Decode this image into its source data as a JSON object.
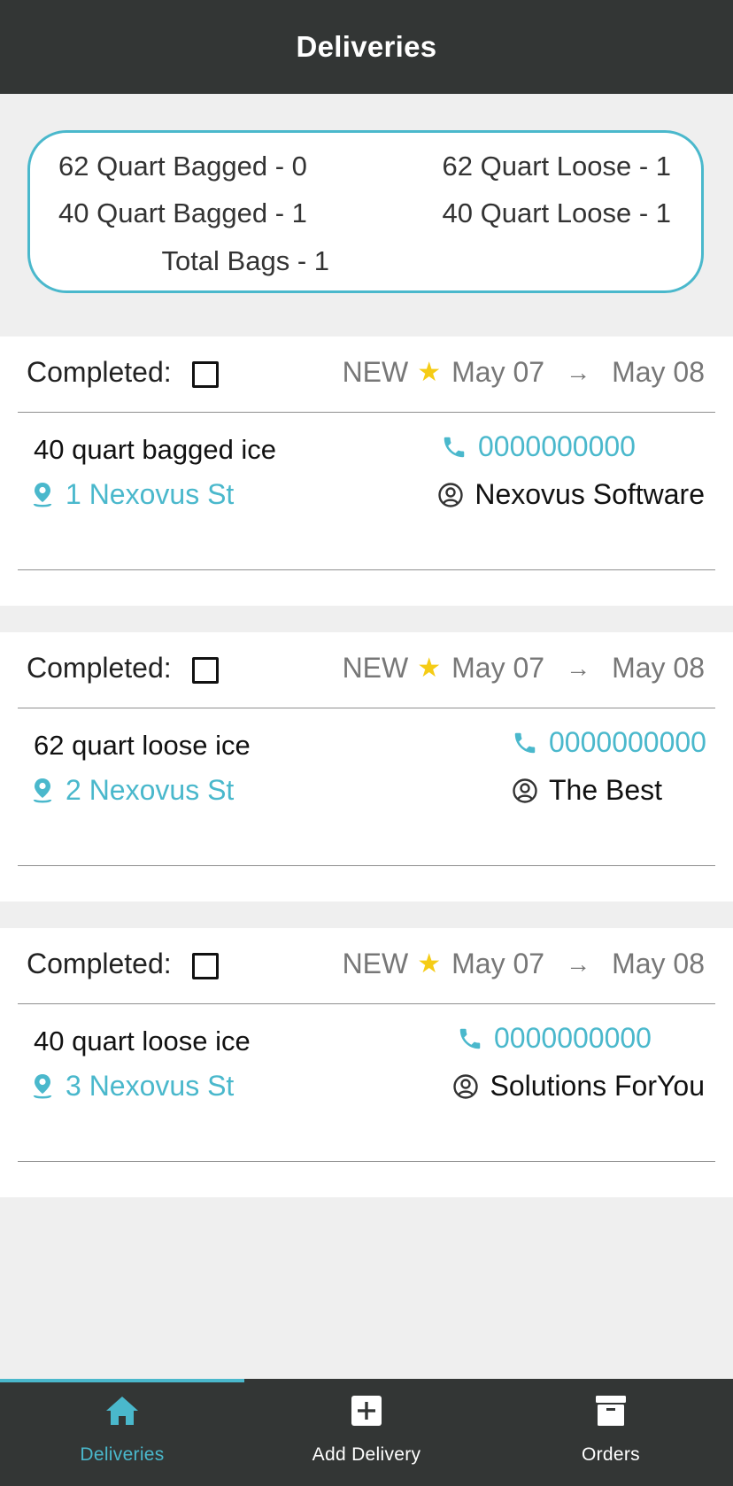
{
  "header": {
    "title": "Deliveries"
  },
  "summary": {
    "bagged_62": "62 Quart Bagged - 0",
    "bagged_40": "40 Quart Bagged - 1",
    "total_bags": "Total Bags - 1",
    "loose_62": "62 Quart Loose - 1",
    "loose_40": "40 Quart Loose - 1"
  },
  "deliveries": [
    {
      "completed_label": "Completed:",
      "status": "NEW",
      "date_from": "May 07",
      "arrow": "→",
      "date_to": "May 08",
      "item": "40 quart bagged ice",
      "address": "1 Nexovus St",
      "phone": "0000000000",
      "customer": "Nexovus Software"
    },
    {
      "completed_label": "Completed:",
      "status": "NEW",
      "date_from": "May 07",
      "arrow": "→",
      "date_to": "May 08",
      "item": "62 quart loose ice",
      "address": "2 Nexovus St",
      "phone": "0000000000",
      "customer": "The Best"
    },
    {
      "completed_label": "Completed:",
      "status": "NEW",
      "date_from": "May 07",
      "arrow": "→",
      "date_to": "May 08",
      "item": "40 quart loose ice",
      "address": "3 Nexovus St",
      "phone": "0000000000",
      "customer": "Solutions ForYou"
    }
  ],
  "tabs": [
    {
      "label": "Deliveries",
      "icon": "home-icon",
      "active": true
    },
    {
      "label": "Add Delivery",
      "icon": "plus-square-icon",
      "active": false
    },
    {
      "label": "Orders",
      "icon": "archive-box-icon",
      "active": false
    }
  ],
  "colors": {
    "accent": "#4ab8cc",
    "header_bg": "#333635",
    "star": "#f5cc16",
    "page_bg": "#efefef"
  }
}
